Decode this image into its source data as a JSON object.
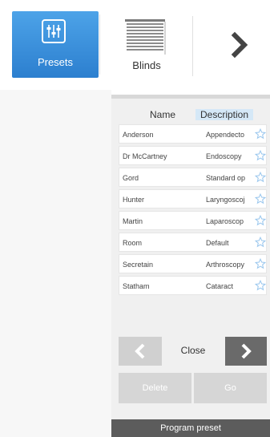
{
  "toolbar": {
    "presets_label": "Presets",
    "blinds_label": "Blinds",
    "next_icon": "chevron-right-icon"
  },
  "table": {
    "headers": {
      "name": "Name",
      "description": "Description"
    },
    "rows": [
      {
        "name": "Anderson",
        "description": "Appendecto",
        "favorite": false
      },
      {
        "name": "Dr McCartney",
        "description": "Endoscopy",
        "favorite": false
      },
      {
        "name": "Gord",
        "description": "Standard op",
        "favorite": false
      },
      {
        "name": "Hunter",
        "description": "Laryngoscoj",
        "favorite": false
      },
      {
        "name": "Martin",
        "description": "Laparoscop",
        "favorite": false
      },
      {
        "name": "Room",
        "description": "Default",
        "favorite": false
      },
      {
        "name": "Secretain",
        "description": "Arthroscopy",
        "favorite": false
      },
      {
        "name": "Statham",
        "description": "Cataract",
        "favorite": false
      }
    ]
  },
  "navigation": {
    "close_label": "Close"
  },
  "actions": {
    "delete_label": "Delete",
    "go_label": "Go"
  },
  "footer": {
    "title": "Program preset"
  },
  "colors": {
    "accent": "#2c7fcf",
    "star": "#9cc8ee",
    "footer_bg": "#5c5c5c",
    "header_highlight": "#d5e8f7"
  }
}
